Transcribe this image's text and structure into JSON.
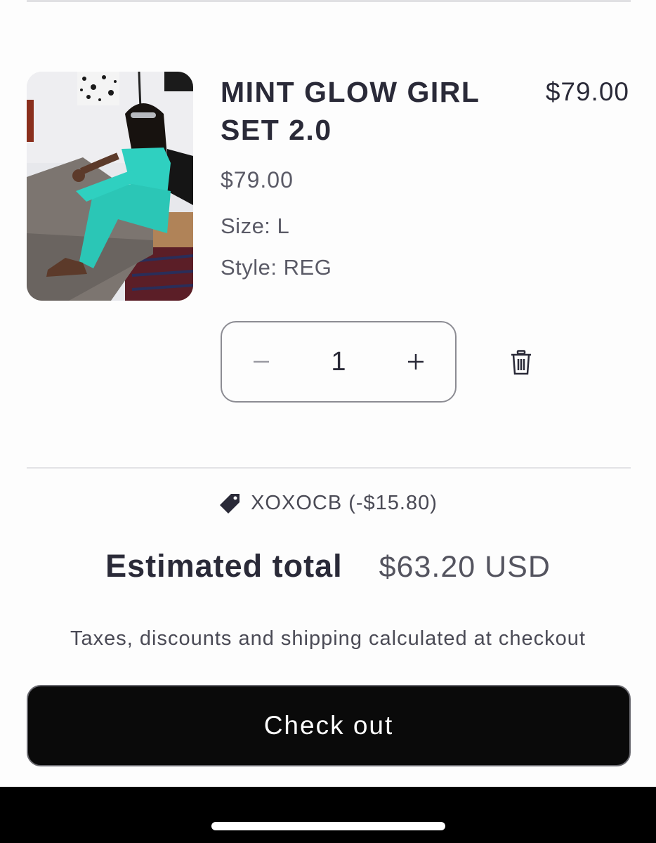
{
  "cart_item": {
    "title": "MINT GLOW GIRL SET 2.0",
    "line_price": "$79.00",
    "unit_price": "$79.00",
    "size": "Size: L",
    "style": "Style: REG",
    "image_icon": "product-photo",
    "quantity": {
      "value": "1",
      "decrease_icon": "minus-icon",
      "increase_icon": "plus-icon"
    },
    "remove_icon": "trash-icon"
  },
  "summary": {
    "discount_icon": "tag-icon",
    "discount": "XOXOCB (-$15.80)",
    "total_label": "Estimated total",
    "total_value": "$63.20 USD",
    "tax_note": "Taxes, discounts and shipping calculated at checkout"
  },
  "checkout": {
    "label": "Check out"
  },
  "colors": {
    "accent": "#0a0a0a",
    "text": "#2a2a38",
    "muted": "#5a5a66",
    "product_teal": "#2fd0c0"
  }
}
